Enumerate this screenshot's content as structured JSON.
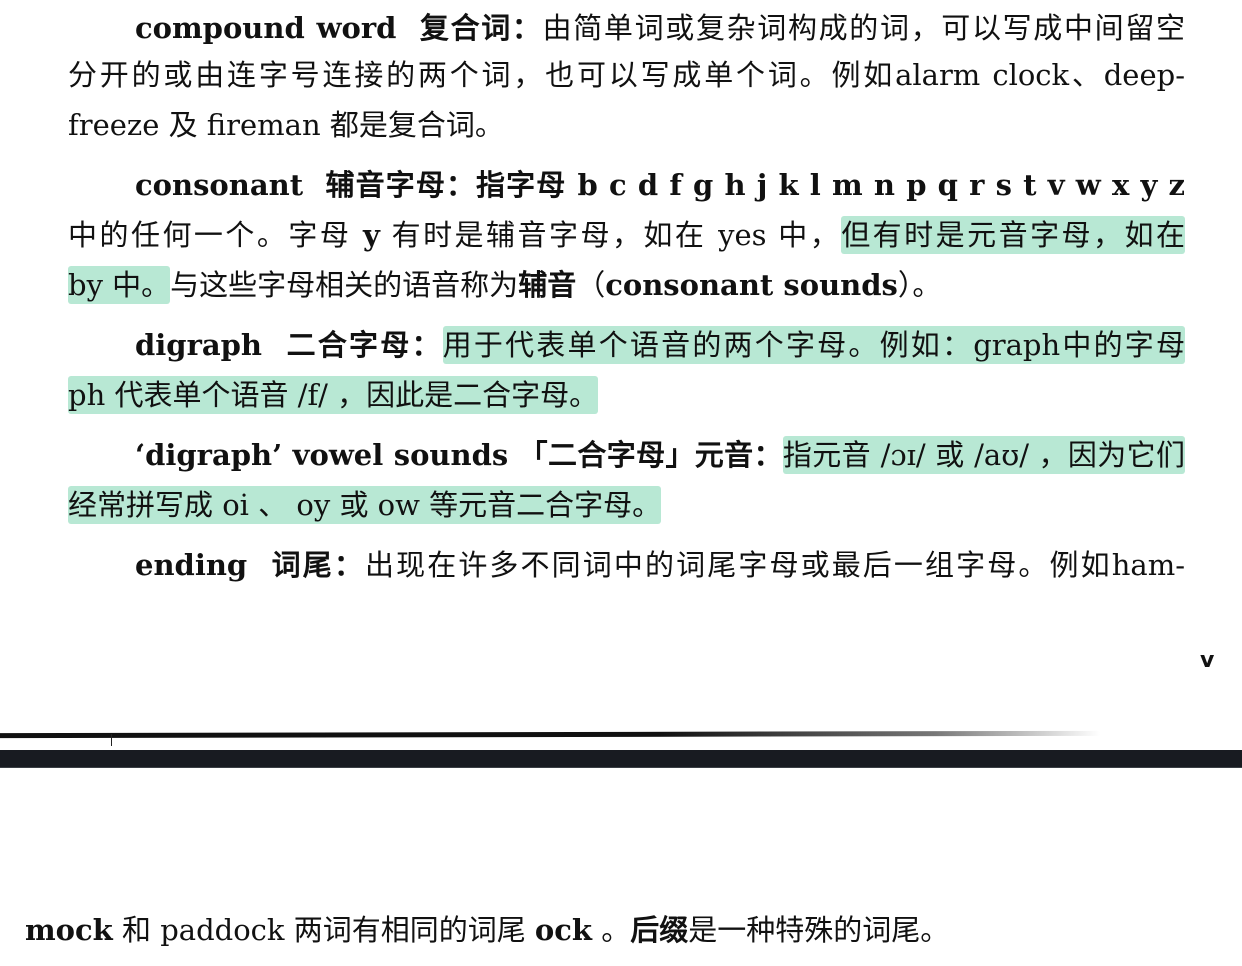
{
  "page_top": {
    "lines": [
      [
        {
          "t": "compound word  复合词：",
          "b": true
        },
        {
          "t": "由简单词或复杂词构成的词，可以写成中间留空"
        }
      ],
      [
        {
          "t": "分开的或由连字号连接的两个词，也可以写成单个词。例如alarm clock、deep-"
        }
      ],
      [
        {
          "t": "freeze 及 fireman 都是复合词。"
        }
      ],
      [
        {
          "t": "consonant  辅音字母：指字母 b c d f g h j k l m n p q r s t v w x y z",
          "b": true
        }
      ],
      [
        {
          "t": "中的任何一个。字母 "
        },
        {
          "t": "y",
          "b": true
        },
        {
          "t": " 有时是辅音字母，如在 yes 中，"
        },
        {
          "t": "但有时是元音字母，如在",
          "h": true
        }
      ],
      [
        {
          "t": "by 中。",
          "h": true
        },
        {
          "t": "与这些字母相关的语音称为"
        },
        {
          "t": "辅音",
          "b": true
        },
        {
          "t": "（"
        },
        {
          "t": "consonant sounds",
          "b": true
        },
        {
          "t": "）。"
        }
      ],
      [
        {
          "t": "digraph  二合字母：",
          "b": true
        },
        {
          "t": "用于代表单个语音的两个字母。例如：graph中的字母",
          "h": true
        }
      ],
      [
        {
          "t": "ph 代表单个语音 /f/ ，因此是二合字母。",
          "h": true
        }
      ],
      [
        {
          "t": "‘digraph’ vowel sounds 「二合字母」元音：",
          "b": true
        },
        {
          "t": "指元音 /ɔɪ/ 或 /aʊ/ ，因为它们",
          "h": true
        }
      ],
      [
        {
          "t": "经常拼写成 oi 、 oy 或 ow 等元音二合字母。",
          "h": true
        }
      ],
      [
        {
          "t": "ending  词尾：",
          "b": true
        },
        {
          "t": "出现在许多不同词中的词尾字母或最后一组字母。例如ham-"
        }
      ]
    ],
    "margin_mark": "v"
  },
  "page_bottom": {
    "lines": [
      [
        {
          "t": "mock",
          "b": true
        },
        {
          "t": " 和 paddock 两词有相同的词尾 "
        },
        {
          "t": "ock",
          "b": true
        },
        {
          "t": " 。"
        },
        {
          "t": "后缀",
          "b": true
        },
        {
          "t": "是一种特殊的词尾。"
        }
      ]
    ]
  },
  "colors": {
    "highlight": "#b8e8d4",
    "divider_bar": "#181b21"
  }
}
